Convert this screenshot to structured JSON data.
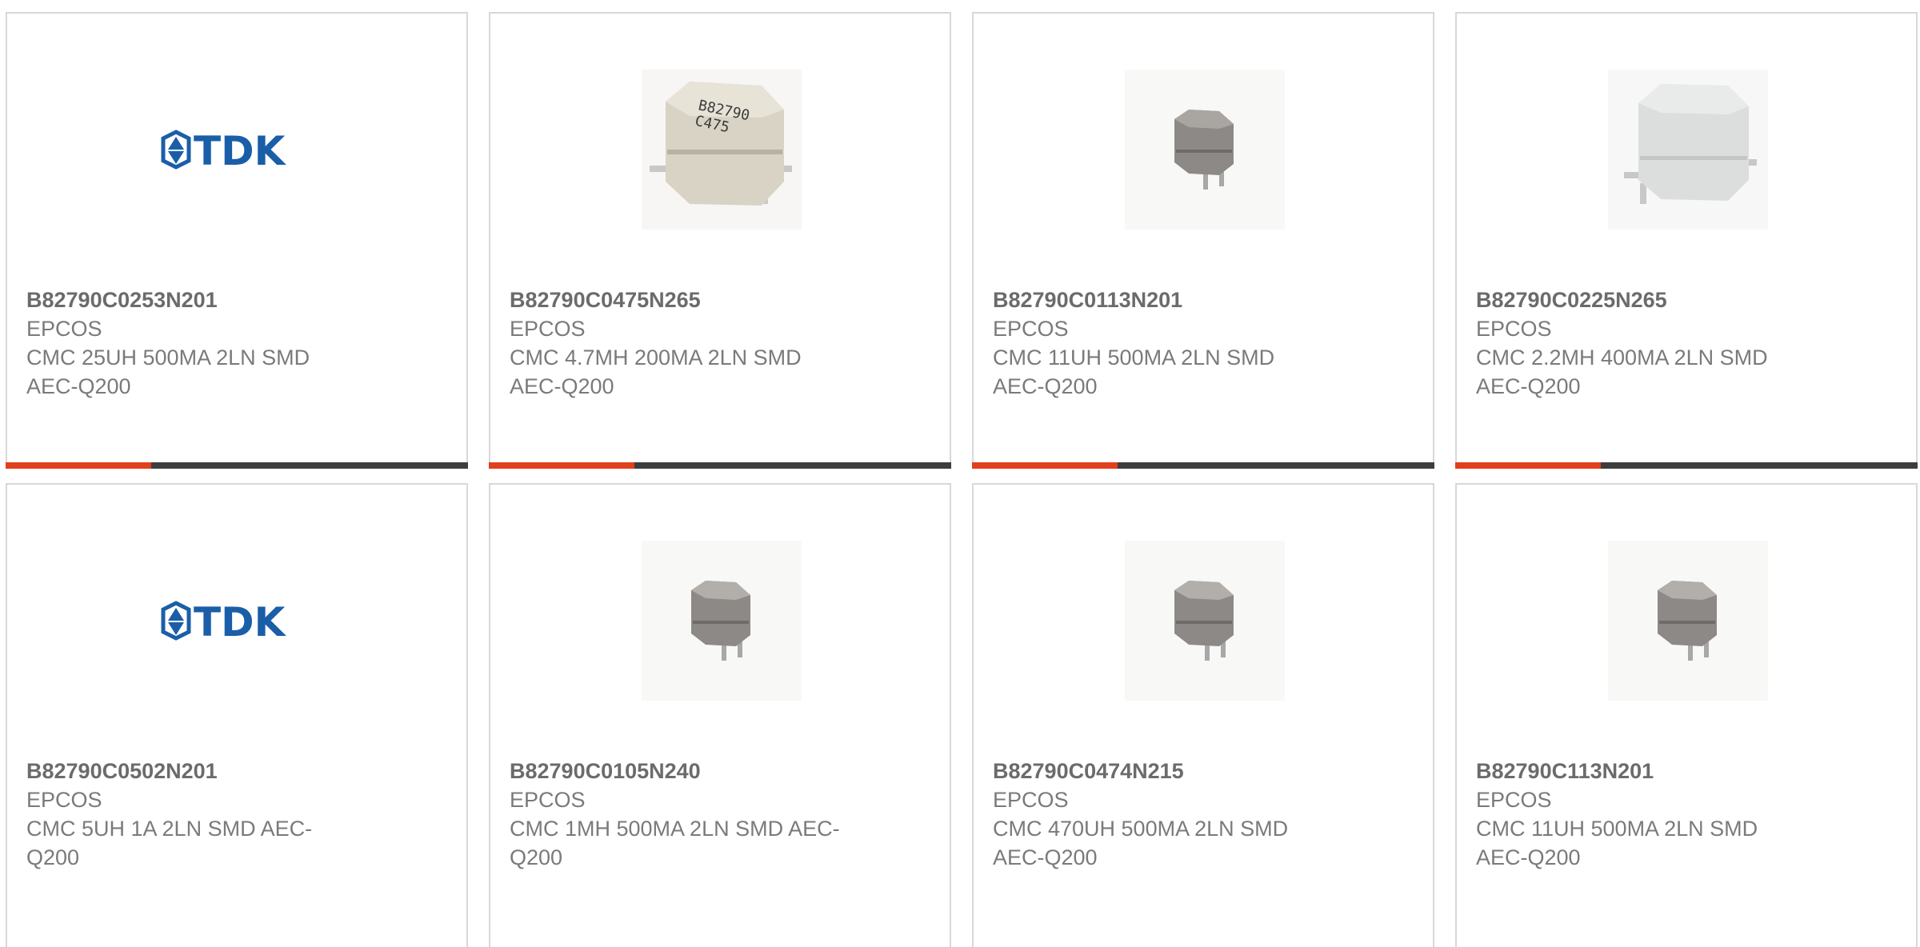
{
  "colors": {
    "accent": "#e0401c",
    "bar_dark": "#3d3d3d",
    "tdk_blue": "#1a5ea8"
  },
  "products": [
    {
      "part": "B82790C0253N201",
      "manufacturer": "EPCOS",
      "description": "CMC 25UH 500MA 2LN SMD AEC-Q200",
      "image": "tdk-logo-icon",
      "logo_text": "TDK"
    },
    {
      "part": "B82790C0475N265",
      "manufacturer": "EPCOS",
      "description": "CMC 4.7MH 200MA 2LN SMD AEC-Q200",
      "image": "large-beige-inductor-icon",
      "component_marking": "B82790\nC475"
    },
    {
      "part": "B82790C0113N201",
      "manufacturer": "EPCOS",
      "description": "CMC 11UH 500MA 2LN SMD AEC-Q200",
      "image": "small-gray-inductor-icon"
    },
    {
      "part": "B82790C0225N265",
      "manufacturer": "EPCOS",
      "description": "CMC 2.2MH 400MA 2LN SMD AEC-Q200",
      "image": "large-white-inductor-icon"
    },
    {
      "part": "B82790C0502N201",
      "manufacturer": "EPCOS",
      "description": "CMC 5UH 1A 2LN SMD AEC-Q200",
      "image": "tdk-logo-icon",
      "logo_text": "TDK"
    },
    {
      "part": "B82790C0105N240",
      "manufacturer": "EPCOS",
      "description": "CMC 1MH 500MA 2LN SMD AEC-Q200",
      "image": "small-gray-inductor-icon"
    },
    {
      "part": "B82790C0474N215",
      "manufacturer": "EPCOS",
      "description": "CMC 470UH 500MA 2LN SMD AEC-Q200",
      "image": "small-gray-inductor-icon"
    },
    {
      "part": "B82790C113N201",
      "manufacturer": "EPCOS",
      "description": "CMC 11UH 500MA 2LN SMD AEC-Q200",
      "image": "small-gray-inductor-icon"
    }
  ]
}
